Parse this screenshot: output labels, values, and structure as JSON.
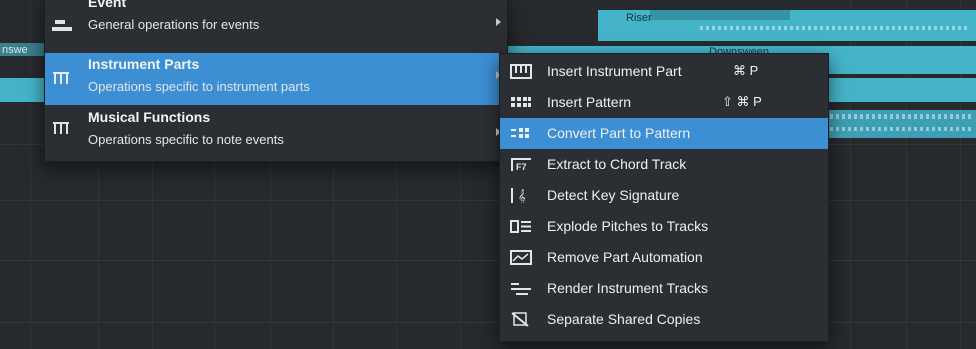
{
  "arrangement": {
    "clips": [
      {
        "label": "Riser"
      },
      {
        "label": "Downsweep"
      },
      {
        "label": "nswe"
      }
    ]
  },
  "context_menu": {
    "items": [
      {
        "title": "Event",
        "description": "General operations for events",
        "icon": "event-icon",
        "selected": false,
        "has_submenu": true
      },
      {
        "title": "Instrument Parts",
        "description": "Operations specific to instrument parts",
        "icon": "instrument-parts-icon",
        "selected": true,
        "has_submenu": true
      },
      {
        "title": "Musical Functions",
        "description": "Operations specific to note events",
        "icon": "musical-functions-icon",
        "selected": false,
        "has_submenu": true
      }
    ]
  },
  "submenu": {
    "items": [
      {
        "label": "Insert Instrument Part",
        "shortcut": "⌘ P",
        "icon": "piano-keys-icon",
        "selected": false
      },
      {
        "label": "Insert Pattern",
        "shortcut": "⇧ ⌘ P",
        "icon": "pattern-grid-icon",
        "selected": false
      },
      {
        "label": "Convert Part to Pattern",
        "shortcut": "",
        "icon": "convert-pattern-icon",
        "selected": true
      },
      {
        "label": "Extract to Chord Track",
        "shortcut": "",
        "icon": "chord-track-icon",
        "selected": false
      },
      {
        "label": "Detect Key Signature",
        "shortcut": "",
        "icon": "key-signature-icon",
        "selected": false
      },
      {
        "label": "Explode Pitches to Tracks",
        "shortcut": "",
        "icon": "explode-pitches-icon",
        "selected": false
      },
      {
        "label": "Remove Part Automation",
        "shortcut": "",
        "icon": "remove-automation-icon",
        "selected": false
      },
      {
        "label": "Render Instrument Tracks",
        "shortcut": "",
        "icon": "render-tracks-icon",
        "selected": false
      },
      {
        "label": "Separate Shared Copies",
        "shortcut": "",
        "icon": "separate-copies-icon",
        "selected": false
      }
    ]
  },
  "colors": {
    "background": "#26292d",
    "menu": "#2b2f34",
    "highlight": "#3c8fd3",
    "clip": "#45b4c9"
  }
}
